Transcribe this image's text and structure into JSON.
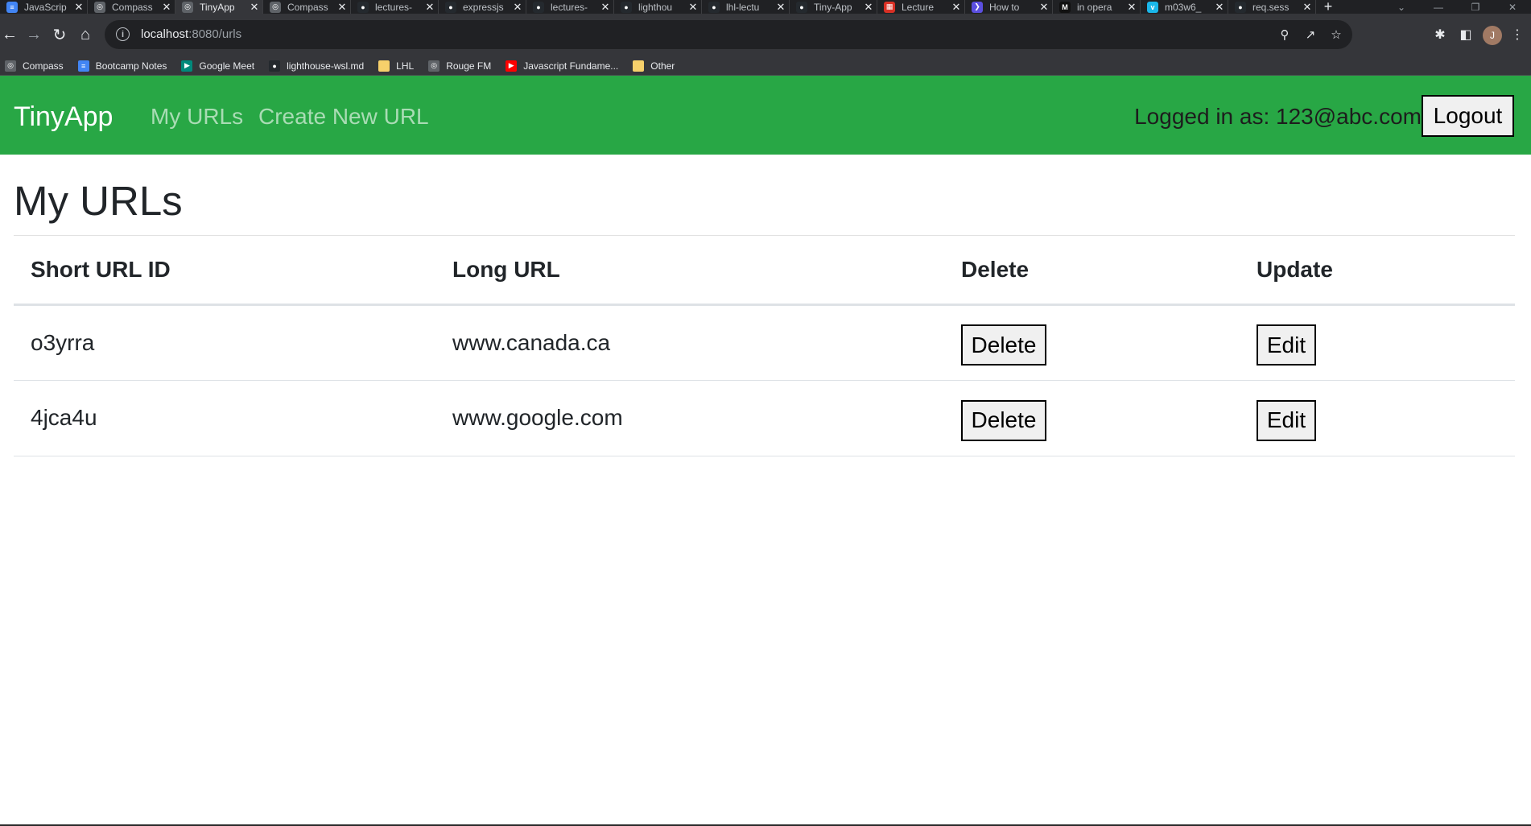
{
  "browser": {
    "tabs": [
      {
        "label": "JavaScrip",
        "icon": "docs-icon",
        "color": "#4285f4"
      },
      {
        "label": "Compass",
        "icon": "compass-icon",
        "color": "#5f6368"
      },
      {
        "label": "TinyApp",
        "icon": "globe-icon",
        "color": "#5f6368",
        "active": true
      },
      {
        "label": "Compass",
        "icon": "compass-icon",
        "color": "#5f6368"
      },
      {
        "label": "lectures-",
        "icon": "github-icon",
        "color": "#24292e"
      },
      {
        "label": "expressjs",
        "icon": "github-icon",
        "color": "#24292e"
      },
      {
        "label": "lectures-",
        "icon": "github-icon",
        "color": "#24292e"
      },
      {
        "label": "lighthou",
        "icon": "github-icon",
        "color": "#24292e"
      },
      {
        "label": "lhl-lectu",
        "icon": "github-icon",
        "color": "#24292e"
      },
      {
        "label": "Tiny-App",
        "icon": "github-icon",
        "color": "#24292e"
      },
      {
        "label": "Lecture",
        "icon": "calendar-icon",
        "color": "#d93025"
      },
      {
        "label": "How to",
        "icon": "terminal-icon",
        "color": "#5b4fe0"
      },
      {
        "label": "in opera",
        "icon": "medium-icon",
        "color": "#111111"
      },
      {
        "label": "m03w6_",
        "icon": "vimeo-icon",
        "color": "#1ab7ea"
      },
      {
        "label": "req.sess",
        "icon": "github-icon",
        "color": "#24292e"
      }
    ],
    "new_tab": "+",
    "url_host": "localhost",
    "url_rest": ":8080/urls",
    "profile_initial": "J",
    "bookmarks": [
      {
        "label": "Compass",
        "icon": "compass-icon",
        "color": "#5f6368"
      },
      {
        "label": "Bootcamp Notes",
        "icon": "docs-icon",
        "color": "#4285f4"
      },
      {
        "label": "Google Meet",
        "icon": "meet-icon",
        "color": "#00897b"
      },
      {
        "label": "lighthouse-wsl.md",
        "icon": "github-icon",
        "color": "#24292e"
      },
      {
        "label": "LHL",
        "icon": "folder-icon",
        "color": "#f6d06b"
      },
      {
        "label": "Rouge FM",
        "icon": "radio-icon",
        "color": "#5f6368"
      },
      {
        "label": "Javascript Fundame...",
        "icon": "youtube-icon",
        "color": "#ff0000"
      },
      {
        "label": "Other",
        "icon": "folder-icon",
        "color": "#f6d06b"
      }
    ]
  },
  "app": {
    "brand": "TinyApp",
    "nav": {
      "my_urls": "My URLs",
      "create_new": "Create New URL"
    },
    "logged_in_text": "Logged in as: 123@abc.com",
    "logout_label": "Logout",
    "accent_color": "#28a745"
  },
  "main": {
    "heading": "My URLs",
    "table": {
      "columns": [
        "Short URL ID",
        "Long URL",
        "Delete",
        "Update"
      ],
      "rows": [
        {
          "short_id": "o3yrra",
          "long_url": "www.canada.ca",
          "delete_label": "Delete",
          "edit_label": "Edit"
        },
        {
          "short_id": "4jca4u",
          "long_url": "www.google.com",
          "delete_label": "Delete",
          "edit_label": "Edit"
        }
      ]
    }
  }
}
